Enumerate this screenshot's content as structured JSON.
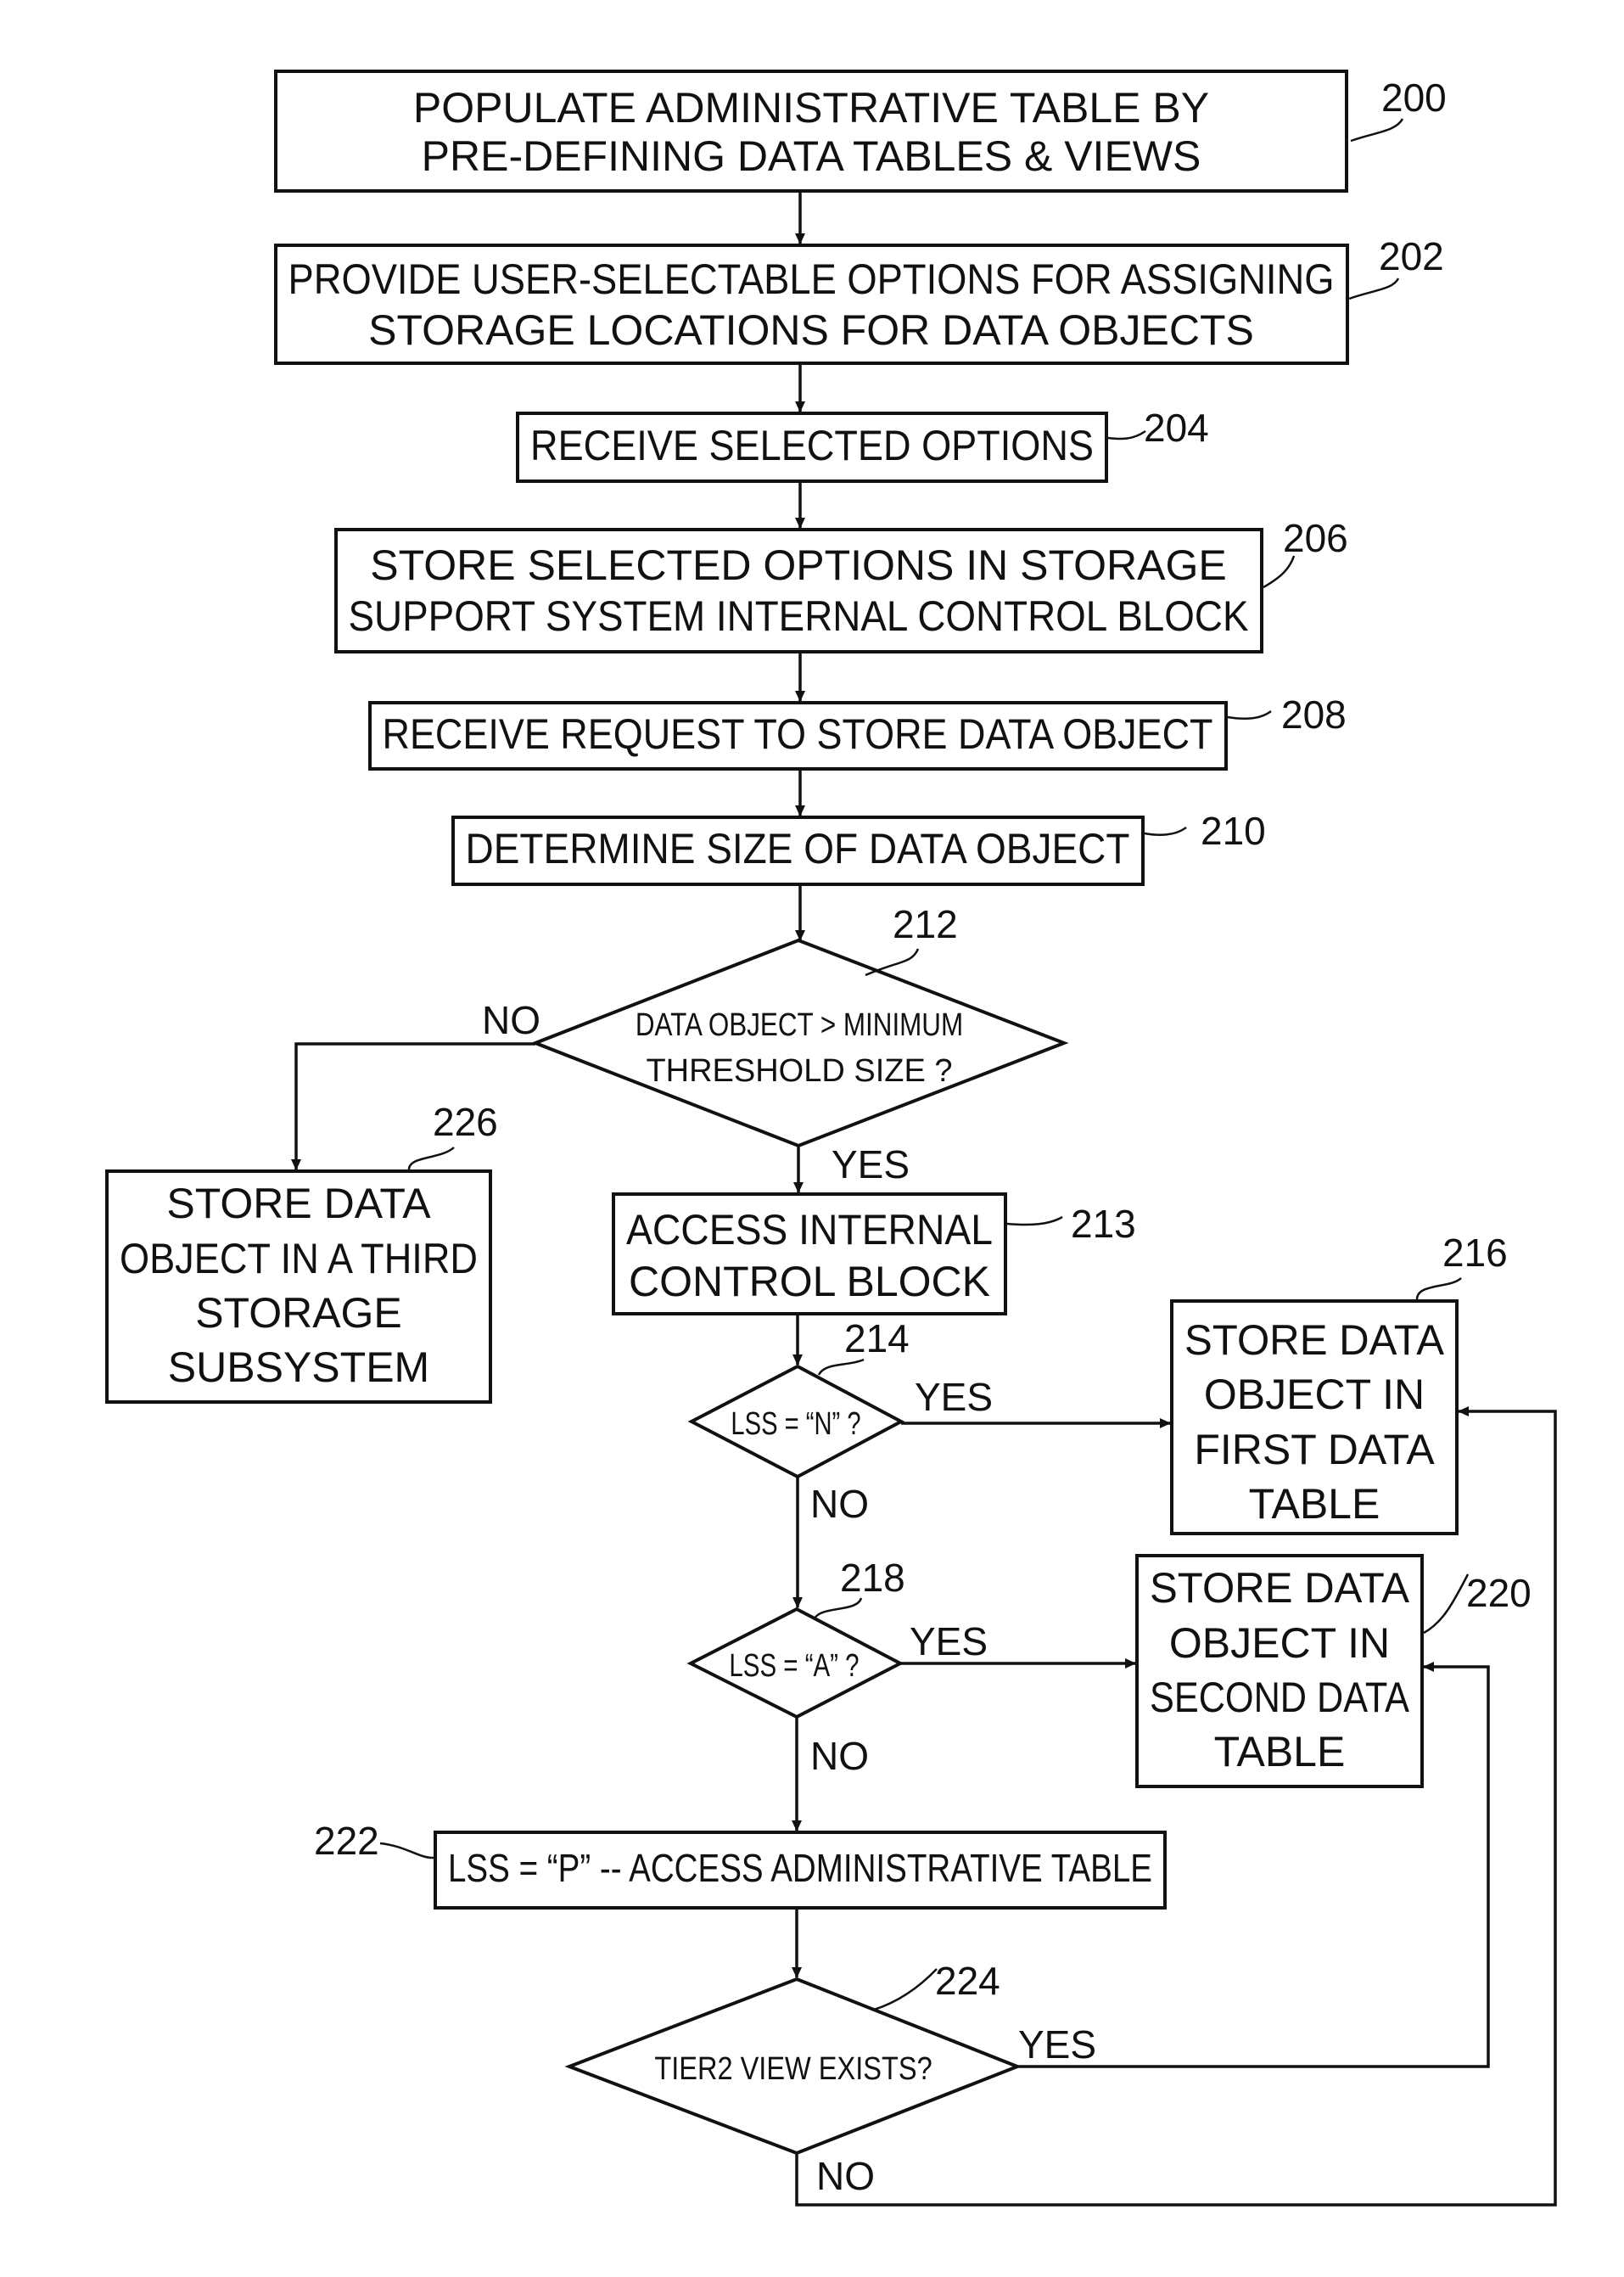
{
  "figure": {
    "steps": [
      {
        "ref": "200",
        "lines": [
          "POPULATE ADMINISTRATIVE TABLE BY",
          "PRE-DEFINING DATA TABLES & VIEWS"
        ]
      },
      {
        "ref": "202",
        "lines": [
          "PROVIDE USER-SELECTABLE OPTIONS FOR ASSIGNING",
          "STORAGE LOCATIONS FOR DATA OBJECTS"
        ]
      },
      {
        "ref": "204",
        "lines": [
          "RECEIVE SELECTED OPTIONS"
        ]
      },
      {
        "ref": "206",
        "lines": [
          "STORE SELECTED OPTIONS IN STORAGE",
          "SUPPORT SYSTEM INTERNAL CONTROL BLOCK"
        ]
      },
      {
        "ref": "208",
        "lines": [
          "RECEIVE REQUEST TO STORE DATA OBJECT"
        ]
      },
      {
        "ref": "210",
        "lines": [
          "DETERMINE SIZE OF DATA OBJECT"
        ]
      },
      {
        "ref": "213",
        "lines": [
          "ACCESS INTERNAL",
          "CONTROL BLOCK"
        ]
      },
      {
        "ref": "216",
        "lines": [
          "STORE DATA",
          "OBJECT IN",
          "FIRST DATA",
          "TABLE"
        ]
      },
      {
        "ref": "220",
        "lines": [
          "STORE DATA",
          "OBJECT IN",
          "SECOND DATA",
          "TABLE"
        ]
      },
      {
        "ref": "222",
        "lines": [
          "LSS = “P” -- ACCESS ADMINISTRATIVE TABLE"
        ]
      },
      {
        "ref": "226",
        "lines": [
          "STORE DATA",
          "OBJECT IN A THIRD",
          "STORAGE",
          "SUBSYSTEM"
        ]
      }
    ],
    "decisions": [
      {
        "ref": "212",
        "lines": [
          "DATA OBJECT > MINIMUM",
          "THRESHOLD SIZE ?"
        ]
      },
      {
        "ref": "214",
        "lines": [
          "LSS = “N” ?"
        ]
      },
      {
        "ref": "218",
        "lines": [
          "LSS = “A” ?"
        ]
      },
      {
        "ref": "224",
        "lines": [
          "TIER2 VIEW EXISTS?"
        ]
      }
    ],
    "branch_labels": {
      "yes": "YES",
      "no": "NO"
    }
  }
}
